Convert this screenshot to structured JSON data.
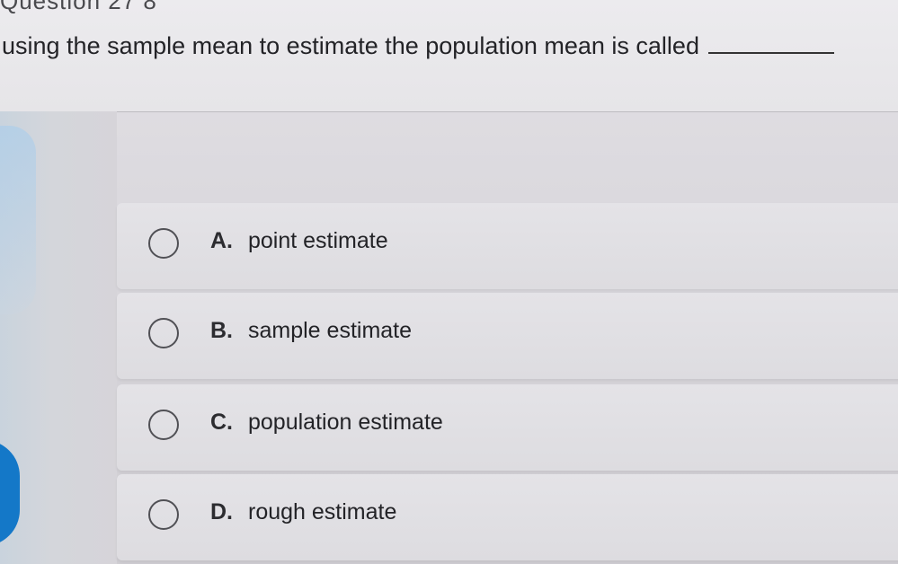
{
  "question": {
    "number_label": "Question 27 8",
    "text": "using the sample mean to estimate the population mean is called"
  },
  "options": [
    {
      "letter": "A.",
      "label": "point estimate"
    },
    {
      "letter": "B.",
      "label": "sample estimate"
    },
    {
      "letter": "C.",
      "label": "population estimate"
    },
    {
      "letter": "D.",
      "label": "rough estimate"
    }
  ],
  "colors": {
    "accent_tab": "#1478c8",
    "option_background": "#e4e3e7",
    "text": "#232327"
  }
}
